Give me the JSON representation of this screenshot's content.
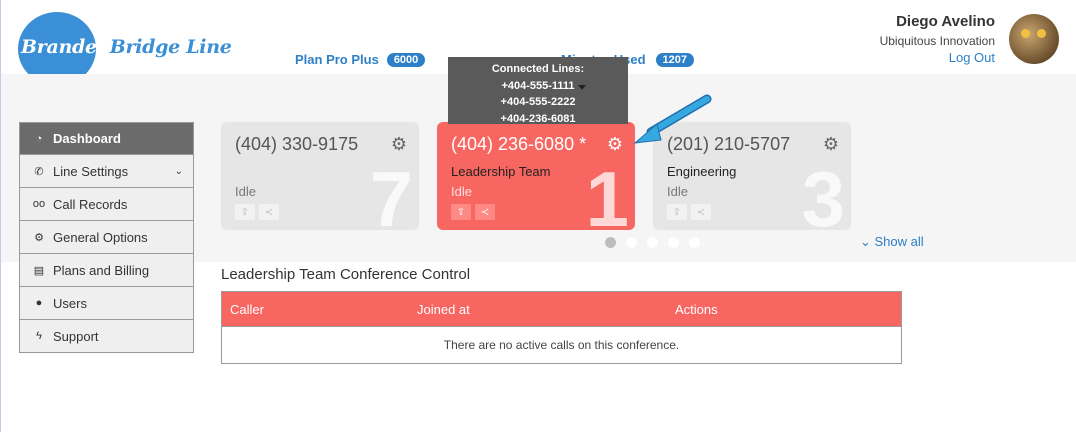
{
  "logo": {
    "text_a": "Branded",
    "text_b": "Bridge Line"
  },
  "plan": {
    "label": "Plan Pro Plus",
    "count": "6000"
  },
  "minutes": {
    "label": "Minutes Used",
    "count": "1207"
  },
  "user": {
    "name": "Diego Avelino",
    "org": "Ubiquitous Innovation",
    "logout": "Log Out"
  },
  "tooltip": {
    "title": "Connected Lines:",
    "lines": [
      "+404-555-1111",
      "+404-555-2222",
      "+404-236-6081"
    ]
  },
  "sidebar": {
    "items": [
      {
        "label": "Dashboard",
        "icon": "dashboard-icon"
      },
      {
        "label": "Line Settings",
        "icon": "phone-icon"
      },
      {
        "label": "Call Records",
        "icon": "voicemail-icon"
      },
      {
        "label": "General Options",
        "icon": "gear-icon"
      },
      {
        "label": "Plans and Billing",
        "icon": "billing-icon"
      },
      {
        "label": "Users",
        "icon": "user-icon"
      },
      {
        "label": "Support",
        "icon": "lightning-icon"
      }
    ]
  },
  "cards": [
    {
      "number": "(404) 330-9175",
      "team": "",
      "status": "Idle",
      "big": "7"
    },
    {
      "number": "(404) 236-6080 *",
      "team": "Leadership Team",
      "status": "Idle",
      "big": "1"
    },
    {
      "number": "(201) 210-5707",
      "team": "Engineering",
      "status": "Idle",
      "big": "3"
    }
  ],
  "carousel": {
    "pages": 5,
    "active": 1
  },
  "show_all": "Show all",
  "conference": {
    "title": "Leadership Team Conference Control",
    "columns": [
      "Caller",
      "Joined at",
      "Actions"
    ],
    "empty": "There are no active calls on this conference."
  },
  "colors": {
    "accent": "#2d7fc8",
    "active_card": "#f76661",
    "sidebar_active": "#6b6b6b"
  }
}
